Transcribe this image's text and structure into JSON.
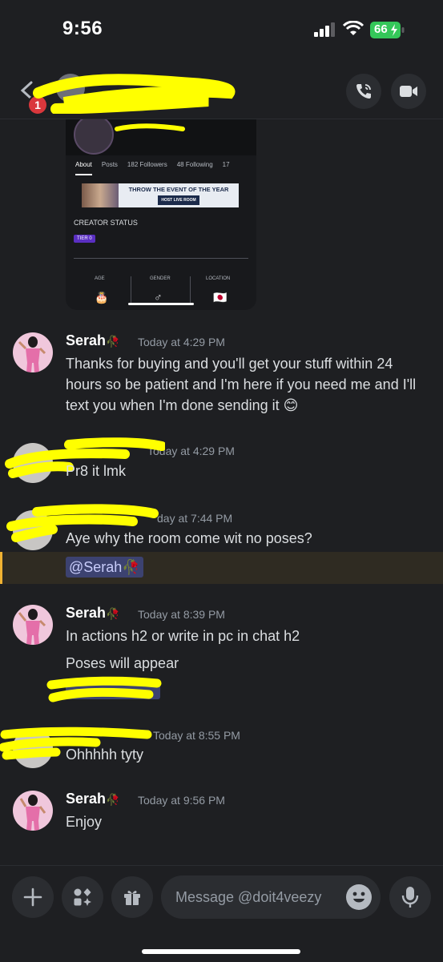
{
  "status_bar": {
    "time": "9:56",
    "battery": "66"
  },
  "header": {
    "unread_badge": "1",
    "call_icon": "phone-call-icon",
    "video_icon": "video-camera-icon"
  },
  "embed": {
    "tabs": [
      "About",
      "Posts",
      "182 Followers",
      "48 Following",
      "17"
    ],
    "banner_title": "THROW THE EVENT OF THE YEAR",
    "banner_sub": "HOST LIVE ROOM",
    "creator_status": "CREATOR STATUS",
    "tier": "TIER 0",
    "columns": [
      "AGE",
      "GENDER",
      "LOCATION"
    ],
    "icons": [
      "🎂",
      "♂",
      "🇯🇵"
    ]
  },
  "messages": [
    {
      "author": "Serah",
      "time": "Today at 4:29 PM",
      "text": "Thanks for buying and you'll get your stuff within 24 hours so be patient and I'm here if you need me and I'll text you when I'm done sending it 😊"
    },
    {
      "author": "",
      "time": "Today at 4:29 PM",
      "text": "Pr8 it lmk"
    },
    {
      "author": "",
      "time": "day at 7:44 PM",
      "text": "Aye why the room come wit no poses?",
      "mention": "@Serah🥀"
    },
    {
      "author": "Serah",
      "time": "Today at 8:39 PM",
      "text": "In actions h2 or write in pc in chat h2",
      "text2": "Poses will appear"
    },
    {
      "author": "",
      "time": "Today at 8:55 PM",
      "text": "Ohhhhh tyty"
    },
    {
      "author": "Serah",
      "time": "Today at 9:56 PM",
      "text": "Enjoy"
    }
  ],
  "author_emoji": "🥀",
  "composer": {
    "placeholder": "Message @doit4veezy"
  }
}
